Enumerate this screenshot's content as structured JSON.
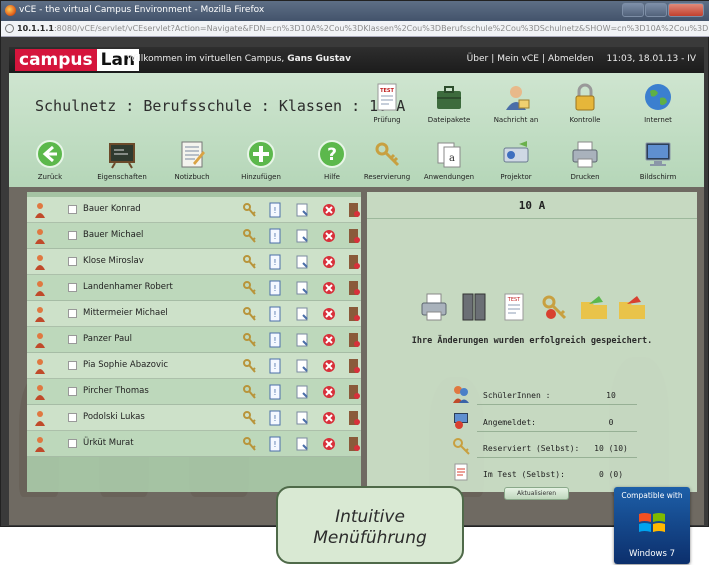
{
  "browser": {
    "title": "vCE - the virtual Campus Environment - Mozilla Firefox",
    "url_host": "10.1.1.1",
    "url_rest": ":8080/vCE/servlet/vCEservlet?Action=Navigate&FDN=cn%3D10A%2Cou%3DKlassen%2Cou%3DBerufsschule%2Cou%3DSchulnetz&SHOW=cn%3D10A%2Cou%3DKlassen%2Cou%3DBerufsschule"
  },
  "header": {
    "logo_part1": "campus",
    "logo_part2": "Lan",
    "welcome": "Willkommen im virtuellen Campus,",
    "user": "Gans Gustav",
    "links": [
      "Über",
      "Mein vCE",
      "Abmelden"
    ],
    "datetime": "11:03, 18.01.13 - IV"
  },
  "breadcrumb": "Schulnetz : Berufsschule : Klassen : 10 A",
  "toolbar_left": [
    {
      "label": "Zurück",
      "icon": "back-arrow-icon"
    },
    {
      "label": "Eigenschaften",
      "icon": "chalkboard-icon"
    },
    {
      "label": "Notizbuch",
      "icon": "notebook-icon"
    },
    {
      "label": "Hinzufügen",
      "icon": "plus-icon"
    },
    {
      "label": "Hilfe",
      "icon": "help-icon"
    }
  ],
  "toolbar_right_row1": [
    {
      "label": "Prüfung",
      "icon": "test-sheet-icon"
    },
    {
      "label": "Dateipakete",
      "icon": "briefcase-icon"
    },
    {
      "label": "Nachricht an",
      "icon": "user-message-icon"
    },
    {
      "label": "Kontrolle",
      "icon": "lock-icon"
    },
    {
      "label": "Internet",
      "icon": "globe-icon"
    }
  ],
  "toolbar_right_row2": [
    {
      "label": "Reservierung",
      "icon": "keys-icon"
    },
    {
      "label": "Anwendungen",
      "icon": "applications-icon"
    },
    {
      "label": "Projektor",
      "icon": "projector-icon"
    },
    {
      "label": "Drucken",
      "icon": "printer-icon"
    },
    {
      "label": "Bildschirm",
      "icon": "monitor-icon"
    }
  ],
  "students": [
    "Bauer Konrad",
    "Bauer Michael",
    "Klose Miroslav",
    "Landenhamer Robert",
    "Mittermeier Michael",
    "Panzer Paul",
    "Pia Sophie Abazovic",
    "Pircher Thomas",
    "Podolski Lukas",
    "Ürküt Murat"
  ],
  "detail": {
    "title": "10 A",
    "saved_message": "Ihre Änderungen wurden erfolgreich gespeichert.",
    "stats": [
      {
        "label": "SchülerInnen :",
        "value": "10",
        "icon": "students-icon"
      },
      {
        "label": "Angemeldet:",
        "value": "0",
        "icon": "logged-in-icon"
      },
      {
        "label": "Reserviert (Selbst):",
        "value": "10 (10)",
        "icon": "reserve-keys-icon"
      },
      {
        "label": "Im Test (Selbst):",
        "value": "0 (0)",
        "icon": "test-doc-icon"
      }
    ],
    "refresh_label": "Aktualisieren"
  },
  "callout": {
    "line1": "Intuitive",
    "line2": "Menüführung"
  },
  "badge": {
    "compatible": "Compatible with",
    "windows": "Windows 7"
  }
}
